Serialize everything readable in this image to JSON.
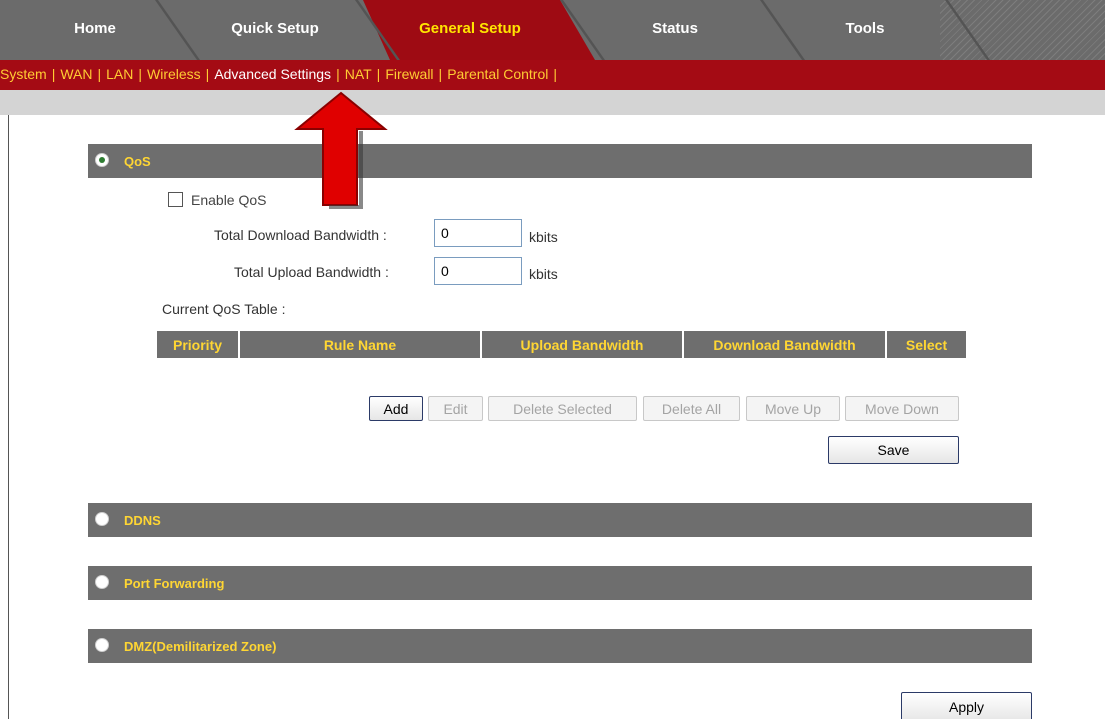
{
  "top_tabs": [
    {
      "label": "Home"
    },
    {
      "label": "Quick Setup"
    },
    {
      "label": "General Setup"
    },
    {
      "label": "Status"
    },
    {
      "label": "Tools"
    }
  ],
  "subnav": [
    {
      "label": "System"
    },
    {
      "label": "WAN"
    },
    {
      "label": "LAN"
    },
    {
      "label": "Wireless"
    },
    {
      "label": "Advanced Settings"
    },
    {
      "label": "NAT"
    },
    {
      "label": "Firewall"
    },
    {
      "label": "Parental Control"
    }
  ],
  "subnav_separator": "|",
  "sections": {
    "qos": "QoS",
    "ddns": "DDNS",
    "port_forwarding": "Port Forwarding",
    "dmz": "DMZ(Demilitarized Zone)"
  },
  "qos": {
    "enable_label": "Enable QoS",
    "enabled": false,
    "download_label": "Total Download Bandwidth :",
    "download_value": "0",
    "upload_label": "Total Upload Bandwidth :",
    "upload_value": "0",
    "unit": "kbits",
    "table_label": "Current QoS Table :",
    "columns": [
      "Priority",
      "Rule Name",
      "Upload Bandwidth",
      "Download Bandwidth",
      "Select"
    ],
    "buttons": {
      "add": "Add",
      "edit": "Edit",
      "delete_selected": "Delete Selected",
      "delete_all": "Delete All",
      "move_up": "Move Up",
      "move_down": "Move Down"
    },
    "save": "Save"
  },
  "apply": "Apply",
  "colors": {
    "active_tab_red": "#9e0b13",
    "subnav_red": "#a40b14",
    "link_gold": "#ffcc33",
    "section_gray": "#6e6e6e",
    "arrow_red": "#e00000"
  }
}
